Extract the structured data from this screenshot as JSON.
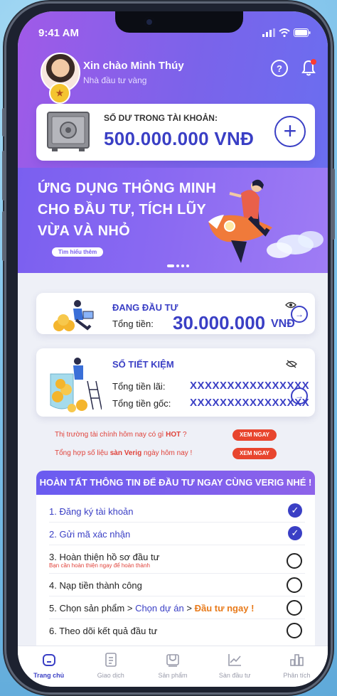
{
  "status": {
    "time": "9:41 AM"
  },
  "user": {
    "greeting": "Xin chào Minh Thúy",
    "role": "Nhà đầu tư vàng"
  },
  "balance": {
    "label": "SỐ DƯ TRONG TÀI KHOẢN:",
    "value": "500.000.000 VNĐ"
  },
  "banner": {
    "lines": [
      "ỨNG DỤNG THÔNG MINH",
      "CHO ĐẦU TƯ, TÍCH LŨY",
      "VỪA VÀ NHỎ"
    ],
    "button": "Tìm hiểu thêm"
  },
  "investing": {
    "title": "ĐANG ĐẦU TƯ",
    "total_label": "Tổng tiền:",
    "amount": "30.000.000",
    "currency": "VNĐ"
  },
  "savings": {
    "title": "SỔ TIẾT KIỆM",
    "interest_label": "Tổng tiền lãi:",
    "interest_value": "XXXXXXXXXXXXXXXX",
    "principal_label": "Tổng tiền gốc:",
    "principal_value": "XXXXXXXXXXXXXXXX"
  },
  "market": {
    "line1_prefix": "Thị trường tài chính hôm nay có gì ",
    "line1_highlight": "HOT",
    "line1_suffix": " ?",
    "line2_prefix": "Tổng hợp số liệu ",
    "line2_highlight": "sàn Verig",
    "line2_suffix": " ngày hôm nay !",
    "button": "XEM NGAY"
  },
  "tasks": {
    "header": "HOÀN TẤT THÔNG TIN ĐỂ ĐẦU TƯ NGAY CÙNG VERIG NHÉ !",
    "items": [
      {
        "text": "1. Đăng ký tài khoản",
        "done": true
      },
      {
        "text": "2. Gửi mã xác nhận",
        "done": true
      },
      {
        "text": "3. Hoàn thiện hồ sơ đầu tư",
        "sub": "Bạn cần hoàn thiện ngay để hoàn thành",
        "done": false
      },
      {
        "text": "4. Nạp tiền thành công",
        "done": false
      },
      {
        "text": "5. Chọn sản phẩm > Chọn dự án > Đầu tư ngay !",
        "done": false
      },
      {
        "text": "6. Theo dõi kết quả đầu tư",
        "done": false
      }
    ],
    "step5": {
      "a": "5. Chọn sản phẩm > ",
      "b": "Chọn dự án",
      "c": " > ",
      "d": "Đầu tư ngay !"
    }
  },
  "tabs": [
    {
      "label": "Trang chủ",
      "icon": "home-icon",
      "active": true
    },
    {
      "label": "Giao dịch",
      "icon": "transaction-icon",
      "active": false
    },
    {
      "label": "Sản phẩm",
      "icon": "product-icon",
      "active": false
    },
    {
      "label": "Sàn đầu tư",
      "icon": "chart-icon",
      "active": false
    },
    {
      "label": "Phân tích",
      "icon": "analysis-icon",
      "active": false
    }
  ],
  "colors": {
    "primary": "#3a3fc5",
    "header": "#7b63ea",
    "accent": "#e8452e"
  }
}
